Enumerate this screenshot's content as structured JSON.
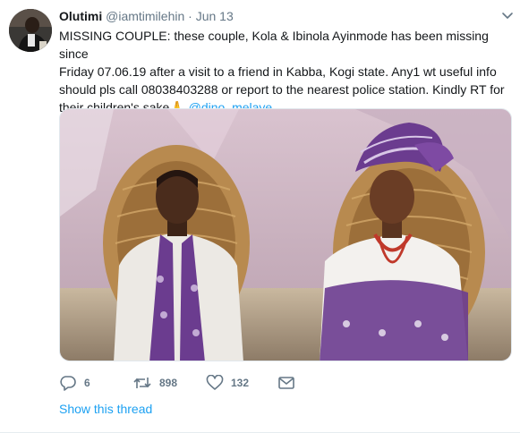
{
  "user": {
    "name": "Olutimi",
    "handle": "@iamtimilehin",
    "separator": "·",
    "time": "Jun 13"
  },
  "tweet": {
    "line1": "MISSING COUPLE: these couple, Kola & Ibinola Ayinmode has been missing since",
    "line2": "Friday 07.06.19 after a visit to a friend in Kabba, Kogi state. Any1 wt useful info",
    "line3": "should pls call 08038403288 or report to the nearest police station. Kindly RT for",
    "line4_prefix": "their children's sake",
    "emoji": "🙏",
    "mention": "@dino_melaye"
  },
  "actions": {
    "replies": "6",
    "retweets": "898",
    "likes": "132"
  },
  "show_thread": "Show this thread",
  "colors": {
    "accent": "#1da1f2",
    "muted": "#657786",
    "text": "#14171a",
    "purple": "#6b3c8f"
  }
}
